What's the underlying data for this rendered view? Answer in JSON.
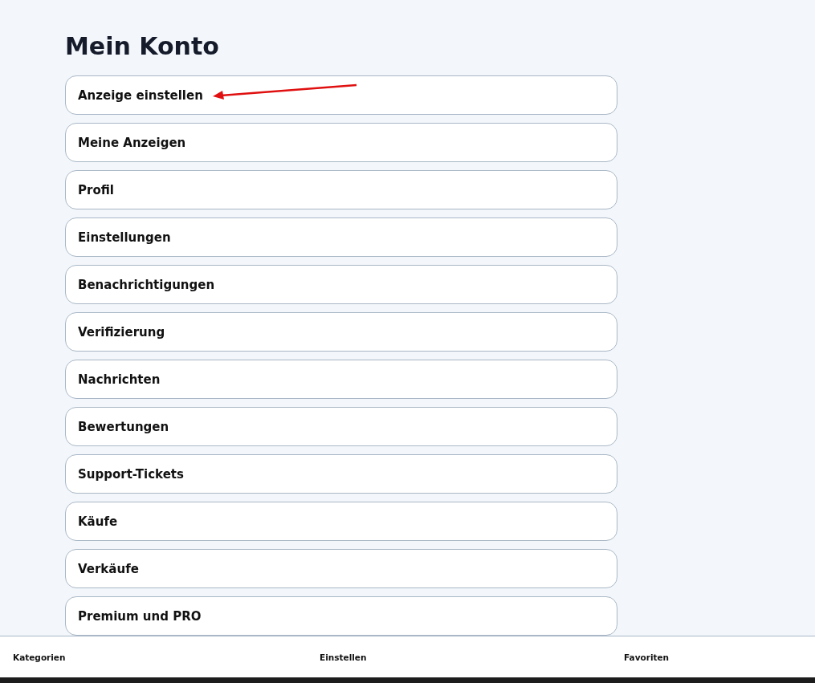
{
  "title": "Mein Konto",
  "items": [
    {
      "label": "Anzeige einstellen",
      "marked": true
    },
    {
      "label": "Meine Anzeigen",
      "marked": false
    },
    {
      "label": "Profil",
      "marked": false
    },
    {
      "label": "Einstellungen",
      "marked": false
    },
    {
      "label": "Benachrichtigungen",
      "marked": false
    },
    {
      "label": "Verifizierung",
      "marked": false
    },
    {
      "label": "Nachrichten",
      "marked": false
    },
    {
      "label": "Bewertungen",
      "marked": false
    },
    {
      "label": "Support-Tickets",
      "marked": false
    },
    {
      "label": "Käufe",
      "marked": false
    },
    {
      "label": "Verkäufe",
      "marked": false
    },
    {
      "label": "Premium und PRO",
      "marked": false
    }
  ],
  "bottom_nav": [
    "Kategorien",
    "Einstellen",
    "Favoriten"
  ]
}
